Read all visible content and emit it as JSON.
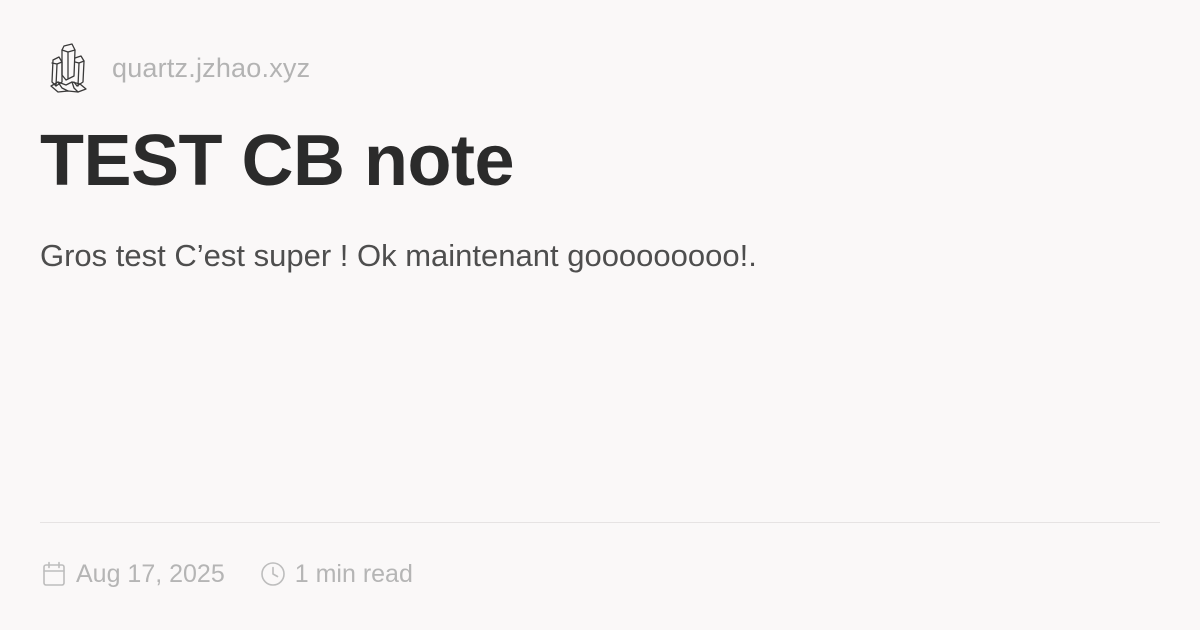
{
  "site": {
    "logo_icon": "crystal-icon",
    "domain": "quartz.jzhao.xyz"
  },
  "page": {
    "title": "TEST CB note",
    "description": "Gros test C’est super ! Ok maintenant gooooooooo!."
  },
  "meta": {
    "date_icon": "calendar-icon",
    "date": "Aug 17, 2025",
    "reading_time_icon": "clock-icon",
    "reading_time": "1 min read"
  },
  "colors": {
    "background": "#faf8f8",
    "title": "#2b2b2b",
    "description": "#4e4e4e",
    "muted": "#b3b3b3",
    "divider": "#e6e3e3"
  }
}
